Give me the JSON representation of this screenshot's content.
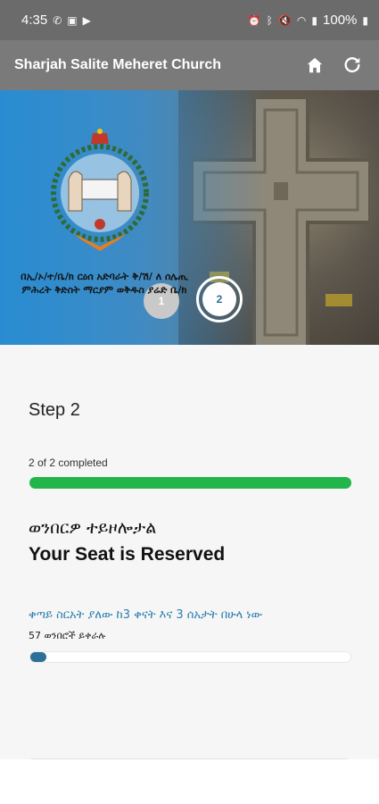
{
  "status_bar": {
    "time": "4:35",
    "battery": "100%",
    "left_icons": [
      "phone-wifi-icon",
      "image-icon",
      "youtube-icon"
    ],
    "right_icons": [
      "alarm-icon",
      "bluetooth-icon",
      "mute-icon",
      "wifi-icon",
      "signal-icon",
      "battery-icon"
    ]
  },
  "appbar": {
    "title": "Sharjah Salite Meheret Church",
    "actions": [
      "home-icon",
      "refresh-icon"
    ]
  },
  "hero": {
    "church_name": "በኢ/ኦ/ተ/ቤ/ክ ርዕሰ አድባራት ቅ/ሽ/ ለ ሰሌጢ ምሕረት ቅድስት ማርያም ወቅዱስ ያሬድ ቤ/ክ",
    "steps": [
      "1",
      "2"
    ],
    "active_step": "2"
  },
  "step": {
    "title": "Step 2",
    "completed_text": "2 of 2 completed",
    "progress": 1.0,
    "progress_color": "#22b64a"
  },
  "reservation": {
    "title_amharic": "ወንበርዎ ተይዞሎታል",
    "title_english": "Your Seat is Reserved"
  },
  "next_service": {
    "text": "ቀጣይ ስርአት ያለው ከ3 ቀናት እና 3 ሰአታት በሁላ ነው",
    "seats_left": "57 ወንበሮች ይቀራሉ",
    "progress": 0.05,
    "progress_color": "#2e6f97"
  }
}
